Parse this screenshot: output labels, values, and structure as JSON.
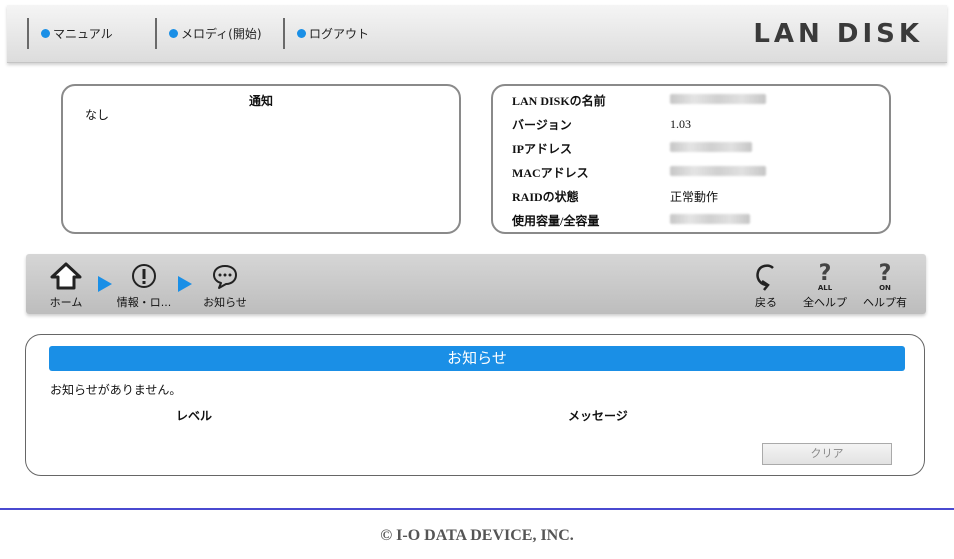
{
  "header": {
    "links": [
      {
        "label": "マニュアル"
      },
      {
        "label": "メロディ(開始)"
      },
      {
        "label": "ログアウト"
      }
    ],
    "logo_text": "LAN DISK"
  },
  "notice": {
    "title": "通知",
    "body": "なし"
  },
  "info": {
    "rows": [
      {
        "key": "LAN DISKの名前",
        "value": ""
      },
      {
        "key": "バージョン",
        "value": "1.03"
      },
      {
        "key": "IPアドレス",
        "value": ""
      },
      {
        "key": "MACアドレス",
        "value": ""
      },
      {
        "key": "RAIDの状態",
        "value": "正常動作"
      },
      {
        "key": "使用容量/全容量",
        "value": ""
      }
    ]
  },
  "toolbar": {
    "breadcrumb": [
      {
        "label": "ホーム",
        "icon": "home-icon"
      },
      {
        "label": "情報・ロ...",
        "icon": "info-alert-icon"
      },
      {
        "label": "お知らせ",
        "icon": "chat-bubble-icon"
      }
    ],
    "right": [
      {
        "label": "戻る",
        "icon": "back-icon"
      },
      {
        "label": "全ヘルプ",
        "icon": "help-all-icon",
        "sub": "ALL"
      },
      {
        "label": "ヘルプ有",
        "icon": "help-on-icon",
        "sub": "ON"
      }
    ]
  },
  "news": {
    "title": "お知らせ",
    "message": "お知らせがありません。",
    "columns": [
      "レベル",
      "メッセージ"
    ],
    "clear_label": "クリア"
  },
  "footer": {
    "copyright": "© I-O DATA DEVICE, INC."
  },
  "colors": {
    "accent": "#1a8fe6",
    "rule": "#4a4ad0"
  }
}
